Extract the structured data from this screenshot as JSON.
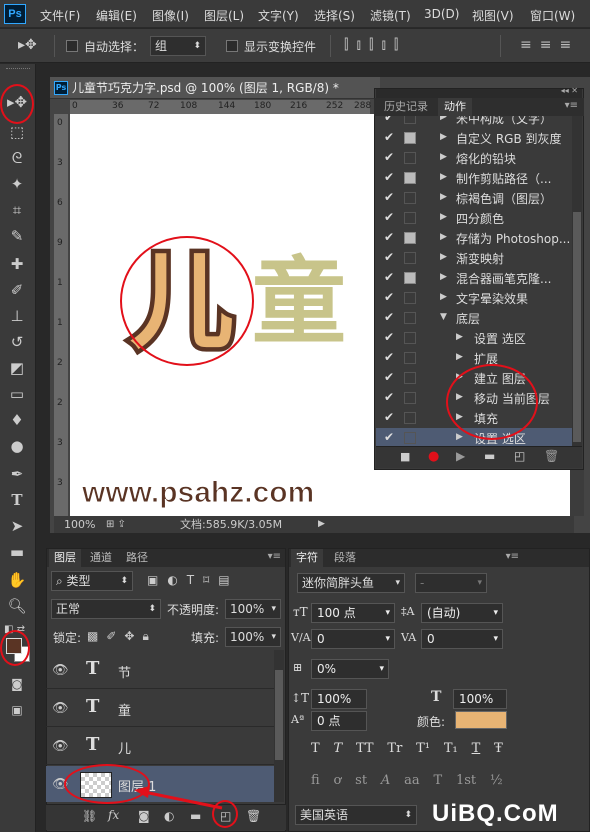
{
  "app": {
    "logo": "Ps"
  },
  "menu": [
    "文件(F)",
    "编辑(E)",
    "图像(I)",
    "图层(L)",
    "文字(Y)",
    "选择(S)",
    "滤镜(T)",
    "3D(D)",
    "视图(V)",
    "窗口(W)"
  ],
  "options": {
    "auto_select_label": "自动选择：",
    "auto_select_value": "组",
    "show_transform_label": "显示变换控件"
  },
  "document": {
    "tab_title": "儿童节巧克力字.psd @ 100% (图层 1, RGB/8) *",
    "ruler_h": [
      "0",
      "36",
      "72",
      "108",
      "144",
      "180",
      "216",
      "252",
      "288"
    ],
    "ruler_v": [
      "0",
      "3",
      "6",
      "9",
      "1",
      "1",
      "2",
      "2",
      "3",
      "3"
    ],
    "canvas_text": {
      "char1": "儿",
      "char2": "童",
      "website": "www.psahz.com"
    },
    "zoom": "100%",
    "doc_size": "文档:585.9K/3.05M"
  },
  "actions_panel": {
    "tabs": [
      "历史记录",
      "动作"
    ],
    "rows": [
      {
        "label": "米中构成（文字）",
        "indent": 0,
        "dialog": false
      },
      {
        "label": "自定义 RGB 到灰度",
        "indent": 0,
        "dialog": true
      },
      {
        "label": "熔化的铅块",
        "indent": 0,
        "dialog": false
      },
      {
        "label": "制作剪贴路径（...",
        "indent": 0,
        "dialog": true
      },
      {
        "label": "棕褐色调（图层）",
        "indent": 0,
        "dialog": false
      },
      {
        "label": "四分颜色",
        "indent": 0,
        "dialog": false
      },
      {
        "label": "存储为 Photoshop...",
        "indent": 0,
        "dialog": true
      },
      {
        "label": "渐变映射",
        "indent": 0,
        "dialog": false
      },
      {
        "label": "混合器画笔克隆...",
        "indent": 0,
        "dialog": true
      },
      {
        "label": "文字晕染效果",
        "indent": 0,
        "dialog": false
      },
      {
        "label": "底层",
        "indent": 0,
        "dialog": false,
        "open": true
      },
      {
        "label": "设置 选区",
        "indent": 1,
        "dialog": false
      },
      {
        "label": "扩展",
        "indent": 1,
        "dialog": false
      },
      {
        "label": "建立 图层",
        "indent": 1,
        "dialog": false
      },
      {
        "label": "移动 当前图层",
        "indent": 1,
        "dialog": false
      },
      {
        "label": "填充",
        "indent": 1,
        "dialog": false
      },
      {
        "label": "设置 选区",
        "indent": 1,
        "dialog": false,
        "selected": true
      }
    ]
  },
  "layers_panel": {
    "tabs": [
      "图层",
      "通道",
      "路径"
    ],
    "filter_label": "类型",
    "blend_mode": "正常",
    "opacity_label": "不透明度:",
    "opacity_value": "100%",
    "lock_label": "锁定:",
    "fill_label": "填充:",
    "fill_value": "100%",
    "layers": [
      {
        "name": "节",
        "type": "text"
      },
      {
        "name": "童",
        "type": "text"
      },
      {
        "name": "儿",
        "type": "text"
      },
      {
        "name": "图层 1",
        "type": "raster",
        "selected": true
      }
    ]
  },
  "character_panel": {
    "tabs": [
      "字符",
      "段落"
    ],
    "font_family": "迷你简胖头鱼",
    "font_style": "-",
    "font_size": "100 点",
    "leading": "(自动)",
    "kerning": "0",
    "tracking": "0",
    "tsume": "0%",
    "vertical_scale": "100%",
    "horizontal_scale": "100%",
    "baseline_shift": "0 点",
    "color_label": "颜色:",
    "color": "#e8b474",
    "language": "美国英语",
    "style_buttons": [
      "T",
      "T",
      "TT",
      "Tr",
      "T¹",
      "T₁",
      "T",
      "Ŧ"
    ],
    "opentype_buttons": [
      "fi",
      "ơ",
      "st",
      "A",
      "aa",
      "T",
      "1st",
      "½"
    ]
  },
  "colors": {
    "accent": "#e2101a",
    "char_brown": "#5a3424",
    "char_fill": "#e8b474",
    "char_olive": "#c8c48a"
  },
  "watermark": "UiBQ.CoM"
}
